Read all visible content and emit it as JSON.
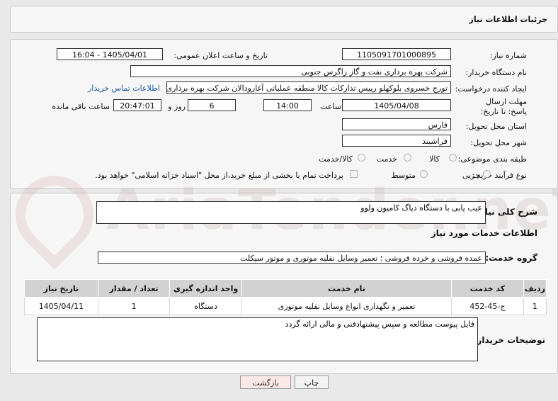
{
  "header": {
    "title": "جزئیات اطلاعات نیاز"
  },
  "watermark": "AriaTender.neT",
  "form": {
    "need_number_label": "شماره نیاز:",
    "need_number": "1105091701000895",
    "announce_label": "تاریخ و ساعت اعلان عمومی:",
    "announce_value": "1405/04/01 - 16:04",
    "buyer_org_label": "نام دستگاه خریدار:",
    "buyer_org": "شرکت بهره برداری نفت و گاز زاگرس جنوبی",
    "creator_label": "ایجاد کننده درخواست:",
    "creator": "تورج خسروی بلوکهلو رییس تدارکات کالا منطقه عملیاتی آغارودالان شرکت بهره برداری",
    "contact_link": "اطلاعات تماس خریدار",
    "deadline_label": "مهلت ارسال پاسخ: تا تاریخ:",
    "deadline_date": "1405/04/08",
    "time_label": "ساعت",
    "deadline_time": "14:00",
    "days_value": "6",
    "days_label": "روز و",
    "remaining_time": "20:47:01",
    "remaining_label": "ساعت باقی مانده",
    "province_label": "استان محل تحویل:",
    "province": "فارس",
    "city_label": "شهر محل تحویل:",
    "city": "فراشبند",
    "category_label": "طبقه بندی موضوعی:",
    "category_options": [
      "کالا",
      "خدمت",
      "کالا/خدمت"
    ],
    "process_label": "نوع فرآیند خرید :",
    "process_options": [
      "جزیی",
      "متوسط"
    ],
    "payment_note": "پرداخت تمام یا بخشی از مبلغ خرید،از محل \"اسناد خزانه اسلامی\" خواهد بود."
  },
  "need_desc": {
    "label": "شرح کلی نیاز:",
    "value": "عیب یابی با دستگاه دیاگ کامیون ولوو"
  },
  "services": {
    "section_title": "اطلاعات خدمات مورد نیاز",
    "group_label": "گروه خدمت:",
    "group_value": "عمده فروشی و خرده فروشی ؛ تعمیر وسایل نقلیه موتوری و موتور سیکلت",
    "columns": [
      "ردیف",
      "کد خدمت",
      "نام خدمت",
      "واحد اندازه گیری",
      "تعداد / مقدار",
      "تاریخ نیاز"
    ],
    "rows": [
      [
        "1",
        "ج-45-452",
        "تعمیر و نگهداری انواع وسایل نقلیه موتوری",
        "دستگاه",
        "1",
        "1405/04/11"
      ]
    ]
  },
  "buyer_notes": {
    "label": "توضیحات خریدار:",
    "value": "فایل پیوست مطالعه و سپس پیشنهادفنی و مالی ارائه گردد"
  },
  "buttons": {
    "print": "چاپ",
    "back": "بازگشت"
  }
}
